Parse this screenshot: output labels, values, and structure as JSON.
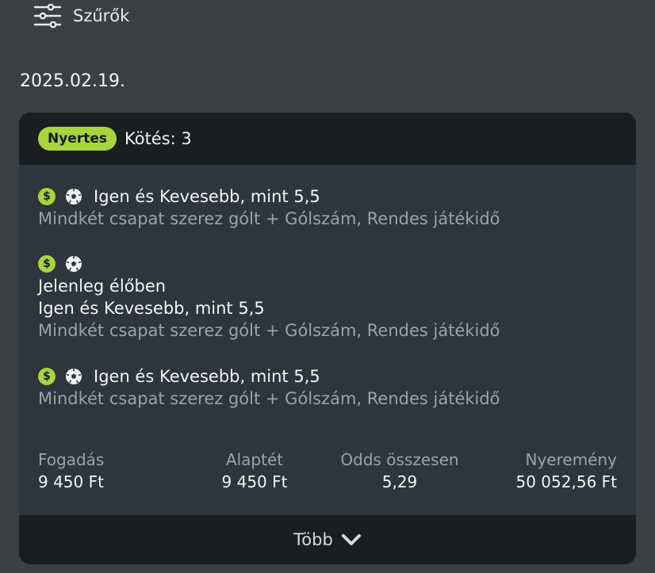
{
  "filters": {
    "label": "Szűrők",
    "icon": "sliders-icon"
  },
  "date": "2025.02.19.",
  "bet": {
    "status_badge": "Nyertes",
    "bet_count": "Kötés: 3",
    "legs": [
      {
        "selection": "Igen és Kevesebb, mint 5,5",
        "market": "Mindkét csapat szerez gólt + Gólszám, Rendes játékidő"
      },
      {
        "live": "Jelenleg élőben",
        "selection": "Igen és Kevesebb, mint 5,5",
        "market": "Mindkét csapat szerez gólt + Gólszám, Rendes játékidő"
      },
      {
        "selection": "Igen és Kevesebb, mint 5,5",
        "market": "Mindkét csapat szerez gólt + Gólszám, Rendes játékidő"
      }
    ],
    "summary": {
      "stake_label": "Fogadás",
      "stake_value": "9 450 Ft",
      "base_label": "Alaptét",
      "base_value": "9 450 Ft",
      "odds_label": "Odds összesen",
      "odds_value": "5,29",
      "payout_label": "Nyeremény",
      "payout_value": "50 052,56 Ft"
    },
    "more_label": "Több"
  },
  "colors": {
    "background": "#3b4045",
    "card": "#2e353c",
    "header": "#1a1e21",
    "accent": "#a8d43e",
    "muted": "#9aa3ab"
  }
}
